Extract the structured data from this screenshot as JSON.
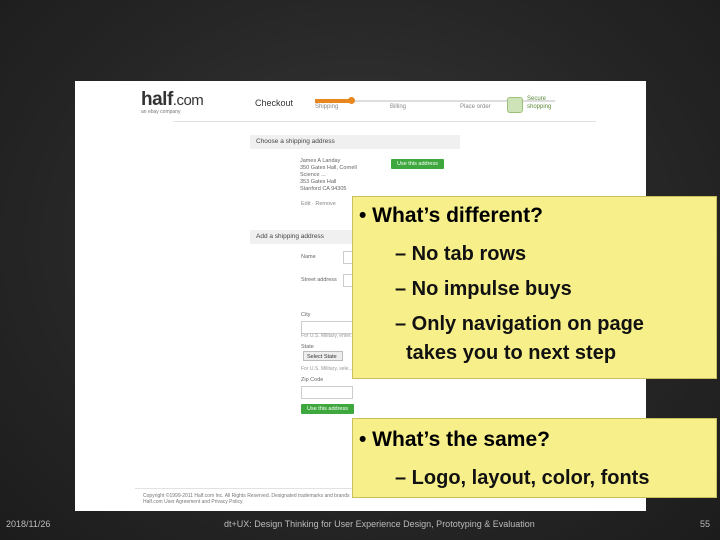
{
  "screenshot": {
    "logo_main": "half",
    "logo_domain": ".com",
    "logo_sub": "an ebay company",
    "checkout_title": "Checkout",
    "steps": [
      "Shipping",
      "Billing",
      "Place order"
    ],
    "secure_label": "Secure shopping",
    "choose_header": "Choose a shipping address",
    "address_lines": [
      "James A Landay",
      "350 Gates Hall, Cornell",
      "Science ...",
      "353 Gates Hall",
      "Stanford CA 94305"
    ],
    "use_this_address_btn": "Use this address",
    "edit_remove": "Edit · Remove",
    "add_header": "Add a shipping address",
    "fields": [
      "Name",
      "Street address",
      "City",
      "State",
      "Zip Code"
    ],
    "city_hint": "For U.S. Military, enter...",
    "state_value": "Select State",
    "state_hint": "For U.S. Military, sele...",
    "use_address_btn": "Use this address",
    "footer_line1": "Copyright ©1999-2011 Half.com Inc. All Rights Reserved. Designated trademarks and brands",
    "footer_line2": "Half.com User Agreement and Privacy Policy."
  },
  "callout_different": {
    "heading": "• What’s different?",
    "items": [
      "– No tab rows",
      "– No impulse buys",
      "– Only navigation on page",
      "takes you to next step"
    ]
  },
  "callout_same": {
    "heading": "• What’s the same?",
    "items": [
      "– Logo, layout, color, fonts"
    ]
  },
  "footer": {
    "date": "2018/11/26",
    "course": "dt+UX: Design Thinking for User Experience Design, Prototyping & Evaluation",
    "page": "55"
  },
  "colors": {
    "callout_bg": "#f7ef8a",
    "button_green": "#3ea83e",
    "step_orange": "#e8871f"
  }
}
